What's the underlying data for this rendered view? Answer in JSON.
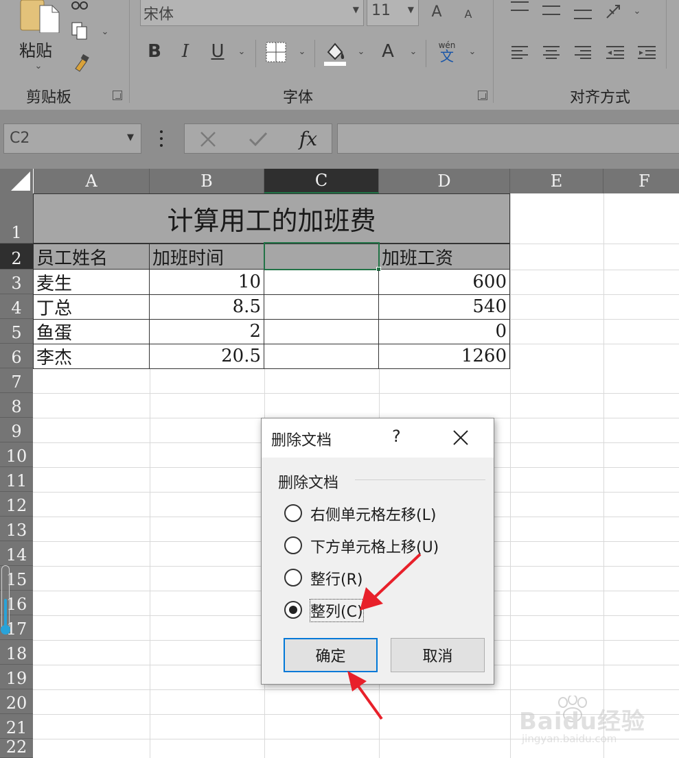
{
  "ribbon": {
    "clipboard": {
      "paste_label": "粘贴",
      "group_label": "剪贴板"
    },
    "font": {
      "font_name": "宋体",
      "font_size": "11",
      "bold": "B",
      "italic": "I",
      "underline": "U",
      "font_color_letter": "A",
      "phonetic_top": "wén",
      "phonetic_bottom": "文",
      "grow_letter": "A",
      "shrink_letter": "A",
      "group_label": "字体"
    },
    "alignment": {
      "group_label": "对齐方式"
    }
  },
  "formula_bar": {
    "name_box": "C2",
    "fx_label": "fx",
    "value": ""
  },
  "sheet": {
    "columns": [
      "A",
      "B",
      "C",
      "D",
      "E",
      "F"
    ],
    "rows": [
      "1",
      "2",
      "3",
      "4",
      "5",
      "6",
      "7",
      "8",
      "9",
      "10",
      "11",
      "12",
      "13",
      "14",
      "15",
      "16",
      "17",
      "18",
      "19",
      "20",
      "21",
      "22"
    ],
    "title": "计算用工的加班费",
    "headers": {
      "a": "员工姓名",
      "b": "加班时间",
      "c": "",
      "d": "加班工资"
    },
    "data": [
      {
        "name": "麦生",
        "hours": "10",
        "pay": "600"
      },
      {
        "name": "丁总",
        "hours": "8.5",
        "pay": "540"
      },
      {
        "name": "鱼蛋",
        "hours": "2",
        "pay": "0"
      },
      {
        "name": "李杰",
        "hours": "20.5",
        "pay": "1260"
      }
    ]
  },
  "dialog": {
    "title": "删除文档",
    "help": "?",
    "group_label": "删除文档",
    "options": [
      {
        "label": "右侧单元格左移(L)",
        "selected": false
      },
      {
        "label": "下方单元格上移(U)",
        "selected": false
      },
      {
        "label": "整行(R)",
        "selected": false
      },
      {
        "label": "整列(C)",
        "selected": true
      }
    ],
    "ok_label": "确定",
    "cancel_label": "取消"
  },
  "watermark": {
    "brand": "Baidu经验",
    "url": "jingyan.baidu.com"
  },
  "colors": {
    "ribbon_bg": "#a6a6a6",
    "header_bg": "#757575",
    "selected_header": "#2f2f2f",
    "selection_green": "#217346",
    "annotation_red": "#e8202a",
    "primary_button_border": "#0078d7"
  },
  "icons": [
    "paste-icon",
    "cut-icon",
    "copy-icon",
    "format-painter-icon",
    "border-icon",
    "fill-color-icon",
    "font-color-icon",
    "phonetic-icon",
    "align-icon",
    "indent-icon",
    "orientation-icon",
    "cancel-x-icon",
    "confirm-check-icon",
    "fx-icon",
    "select-all-icon",
    "close-icon",
    "arrow-annotation"
  ]
}
